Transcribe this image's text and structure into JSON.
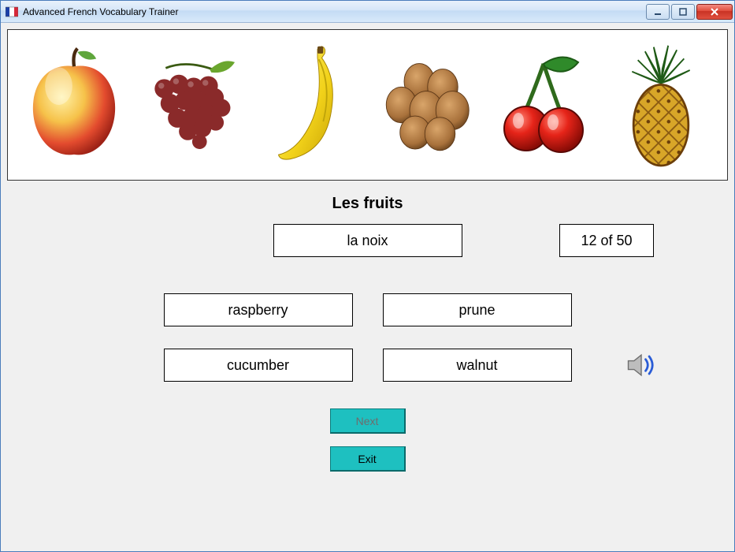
{
  "window": {
    "title": "Advanced French Vocabulary Trainer"
  },
  "category": "Les fruits",
  "prompt_word": "la noix",
  "counter": "12 of 50",
  "answers": [
    "raspberry",
    "prune",
    "cucumber",
    "walnut"
  ],
  "buttons": {
    "next": "Next",
    "exit": "Exit"
  },
  "images": {
    "items": [
      "apple",
      "grapes",
      "banana",
      "walnuts",
      "cherries",
      "pineapple"
    ]
  },
  "icons": {
    "speaker": "speaker-icon",
    "app": "french-flag-icon",
    "minimize": "minimize-icon",
    "maximize": "maximize-icon",
    "close": "close-icon"
  }
}
